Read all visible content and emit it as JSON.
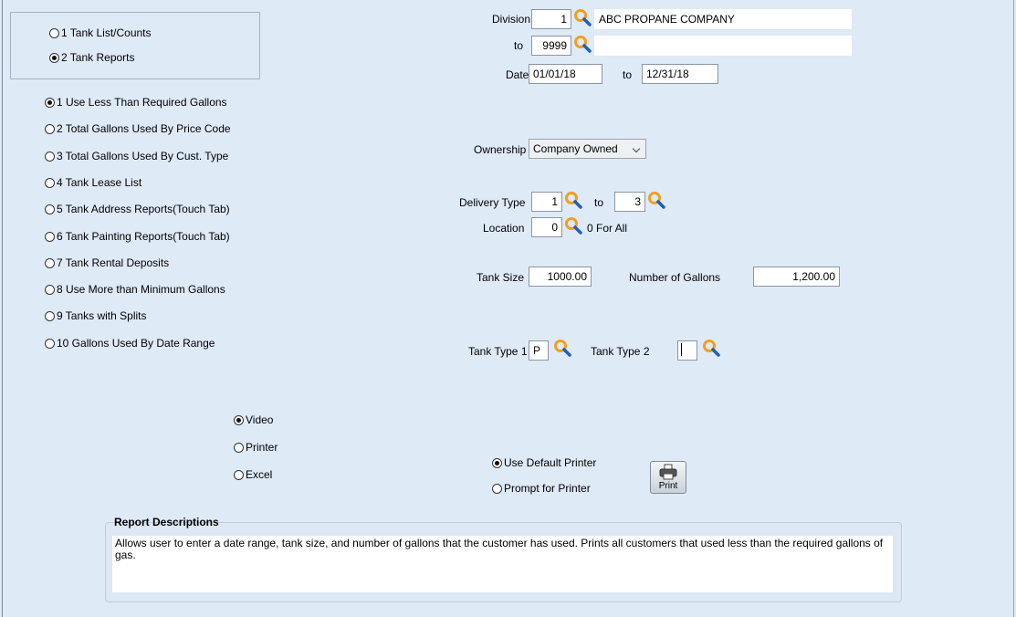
{
  "report_group": {
    "options": [
      {
        "label": "1 Tank List/Counts",
        "selected": false
      },
      {
        "label": "2 Tank Reports",
        "selected": true
      }
    ]
  },
  "report_types": [
    {
      "label": "1 Use Less Than Required Gallons",
      "selected": true
    },
    {
      "label": "2 Total Gallons Used By Price Code",
      "selected": false
    },
    {
      "label": "3 Total Gallons Used By Cust. Type",
      "selected": false
    },
    {
      "label": "4 Tank Lease List",
      "selected": false
    },
    {
      "label": "5 Tank Address Reports(Touch Tab)",
      "selected": false
    },
    {
      "label": "6 Tank Painting Reports(Touch Tab)",
      "selected": false
    },
    {
      "label": "7 Tank Rental Deposits",
      "selected": false
    },
    {
      "label": "8 Use More than Minimum Gallons",
      "selected": false
    },
    {
      "label": "9 Tanks with Splits",
      "selected": false
    },
    {
      "label": "10 Gallons Used By Date Range",
      "selected": false
    }
  ],
  "filters": {
    "division_label": "Division",
    "division_from": "1",
    "division_name": "ABC PROPANE COMPANY",
    "to_label": "to",
    "division_to": "9999",
    "division_to_name": "",
    "date_label": "Date",
    "date_from": "01/01/18",
    "date_to_label": "to",
    "date_to": "12/31/18",
    "ownership_label": "Ownership",
    "ownership_value": "Company Owned",
    "delivery_type_label": "Delivery Type",
    "delivery_from": "1",
    "delivery_to_label": "to",
    "delivery_to": "3",
    "location_label": "Location",
    "location_value": "0",
    "location_hint": "0 For All",
    "tank_size_label": "Tank Size",
    "tank_size": "1000.00",
    "gallons_label": "Number of Gallons",
    "gallons": "1,200.00",
    "tank_type1_label": "Tank Type 1",
    "tank_type1": "P",
    "tank_type2_label": "Tank Type 2",
    "tank_type2": ""
  },
  "output": {
    "options": [
      {
        "label": "Video",
        "selected": true
      },
      {
        "label": "Printer",
        "selected": false
      },
      {
        "label": "Excel",
        "selected": false
      }
    ]
  },
  "printer": {
    "options": [
      {
        "label": "Use Default Printer",
        "selected": true
      },
      {
        "label": "Prompt for Printer",
        "selected": false
      }
    ],
    "print_label": "Print"
  },
  "description": {
    "title": "Report Descriptions",
    "text": "Allows user to enter a date range, tank size, and number of gallons that the customer has used. Prints all customers that used less than the required gallons of gas."
  },
  "colors": {
    "background": "#dfeaf7",
    "magnifier": "#f0a020"
  },
  "icons": {
    "lookup": "magnifier-icon",
    "print": "printer-icon"
  }
}
